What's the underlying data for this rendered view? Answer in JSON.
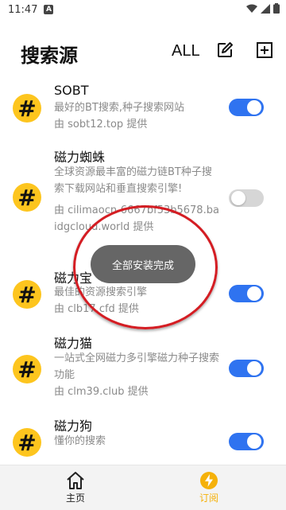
{
  "status_bar": {
    "time": "11:47",
    "notification_badge": "A"
  },
  "header": {
    "title": "搜索源",
    "all_label": "ALL",
    "edit_icon": "edit-icon",
    "add_icon": "add-box-icon"
  },
  "sources": [
    {
      "name": "SOBT",
      "desc": "最好的BT搜索,种子搜索网站",
      "provider": "由 sobt12.top 提供",
      "enabled": true
    },
    {
      "name": "磁力蜘蛛",
      "desc": "全球资源最丰富的磁力链BT种子搜索下载网站和垂直搜索引擎!",
      "provider": "由 cilimaocn-6667bf53b5678.baidgcloud.world 提供",
      "enabled": false
    },
    {
      "name": "磁力宝",
      "desc": "最佳的资源搜索引擎",
      "provider": "由 clb17.cfd 提供",
      "enabled": true
    },
    {
      "name": "磁力猫",
      "desc": "一站式全网磁力多引擎磁力种子搜索功能",
      "provider": "由 clm39.club 提供",
      "enabled": true
    },
    {
      "name": "磁力狗",
      "desc": "懂你的搜索",
      "provider": "",
      "enabled": true
    }
  ],
  "toast": {
    "text": "全部安装完成"
  },
  "bottom_nav": {
    "home_label": "主页",
    "subscribe_label": "订阅",
    "active": "订阅"
  },
  "colors": {
    "accent_blue": "#2f73f0",
    "hash_yellow": "#fdc51e",
    "nav_active": "#f5b10a",
    "annotation_red": "#d41d23"
  }
}
